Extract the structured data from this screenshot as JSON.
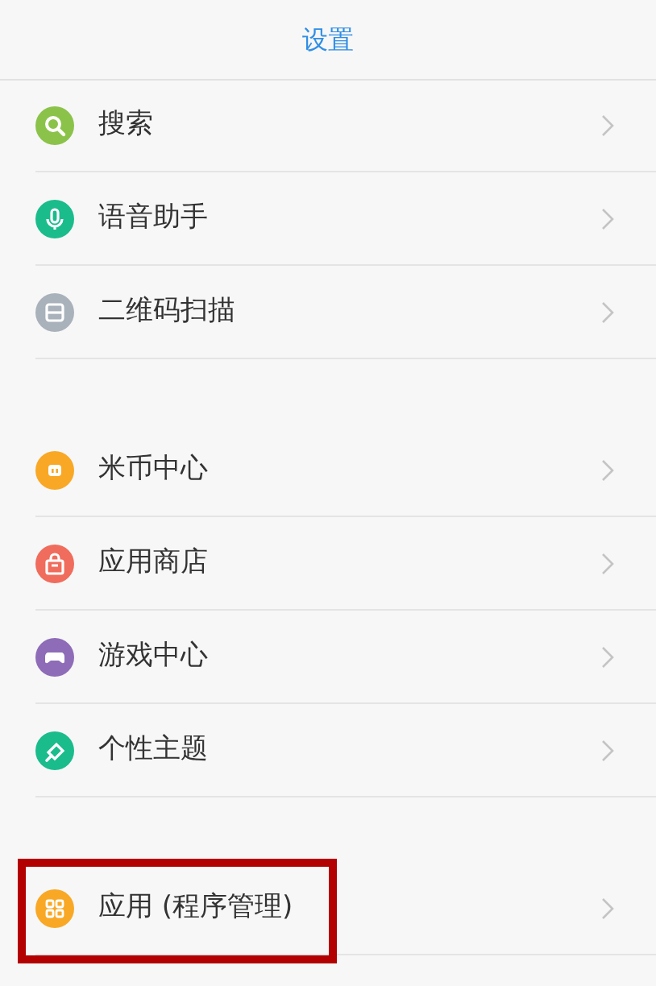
{
  "title": "设置",
  "groups": [
    {
      "items": [
        {
          "label": "搜索",
          "kind": "search",
          "color": "#8bc34a",
          "highlighted": false
        },
        {
          "label": "语音助手",
          "kind": "mic",
          "color": "#1abc8c",
          "highlighted": false
        },
        {
          "label": "二维码扫描",
          "kind": "scan",
          "color": "#a9b1bb",
          "highlighted": false
        }
      ]
    },
    {
      "items": [
        {
          "label": "米币中心",
          "kind": "coin",
          "color": "#f9a825",
          "highlighted": false
        },
        {
          "label": "应用商店",
          "kind": "bag",
          "color": "#f06c5c",
          "highlighted": false
        },
        {
          "label": "游戏中心",
          "kind": "gamepad",
          "color": "#8e6cb8",
          "highlighted": false
        },
        {
          "label": "个性主题",
          "kind": "brush",
          "color": "#1abc8c",
          "highlighted": false
        }
      ]
    },
    {
      "items": [
        {
          "label": "应用 (程序管理)",
          "kind": "apps",
          "color": "#f9a825",
          "highlighted": true
        }
      ]
    }
  ]
}
